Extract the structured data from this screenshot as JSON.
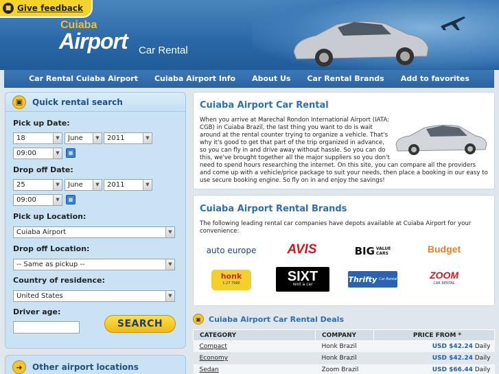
{
  "feedback": {
    "label": "Give feedback"
  },
  "logo": {
    "top": "Cuiaba",
    "main": "Airport",
    "sub": "Car Rental"
  },
  "nav": [
    "Car Rental Cuiaba Airport",
    "Cuiaba Airport Info",
    "About Us",
    "Car Rental Brands",
    "Add to favorites"
  ],
  "search": {
    "title": "Quick rental search",
    "pickup_date_label": "Pick up Date:",
    "pickup_day": "18",
    "pickup_month": "June",
    "pickup_year": "2011",
    "pickup_time": "09:00",
    "dropoff_date_label": "Drop off Date:",
    "dropoff_day": "25",
    "dropoff_month": "June",
    "dropoff_year": "2011",
    "dropoff_time": "09:00",
    "pickup_location_label": "Pick up Location:",
    "pickup_location": "Cuiaba Airport",
    "dropoff_location_label": "Drop off Location:",
    "dropoff_location": "-- Same as pickup --",
    "country_label": "Country of residence:",
    "country": "United States",
    "age_label": "Driver age:",
    "age_value": "",
    "button": "SEARCH"
  },
  "other": {
    "title": "Other airport locations"
  },
  "about": {
    "title": "Cuiaba Airport Car Rental",
    "text": "When you arrive at Marechal Rondon International Airport (IATA: CGB) in Cuiaba Brazil, the last thing you want to do is wait around at the rental counter trying to organize a vehicle. That's why it's good to get that part of the trip organized in advance, so you can fly in and drive away without hassle. So you can do this, we've brought together all the major suppliers so you don't need to spend hours researching the internet. On this site, you can compare all the providers and come up with a vehicle/price package to suit your needs, then place a booking in our easy to use secure booking engine. So fly on in and enjoy the savings!"
  },
  "brands": {
    "title": "Cuiaba Airport Rental Brands",
    "text": "The following leading rental car companies have depots available at Cuiaba Airport for your convenience:",
    "logos": [
      "auto europe",
      "AVIS",
      "BIG VALUE CARS",
      "Budget",
      "honk",
      "SIXT",
      "Thrifty",
      "ZOOM"
    ],
    "logo_extras": {
      "sixt_sub": "rent a car",
      "zoom_sub": "CAR RENTAL",
      "thrifty_sub": "Car Rental",
      "honk_sub": "1.27 7986",
      "big_a": "VALUE",
      "big_b": "CARS"
    }
  },
  "deals": {
    "title": "Cuiaba Airport Car Rental Deals",
    "headers": [
      "CATEGORY",
      "COMPANY",
      "PRICE FROM *"
    ],
    "rows": [
      {
        "category": "Compact",
        "company": "Honk Brazil",
        "price": "USD $42.24",
        "unit": "Daily"
      },
      {
        "category": "Economy",
        "company": "Honk Brazil",
        "price": "USD $42.24",
        "unit": "Daily"
      },
      {
        "category": "Sedan",
        "company": "Zoom Brazil",
        "price": "USD $66.44",
        "unit": "Daily"
      }
    ]
  },
  "colors": {
    "accent": "#2a6fb3",
    "header": "#2a67a6",
    "button": "#f4c42a"
  }
}
